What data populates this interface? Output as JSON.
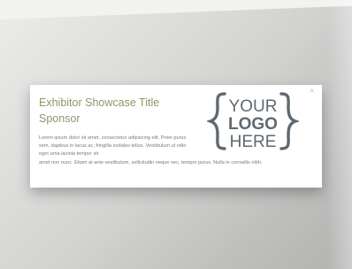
{
  "modal": {
    "title_line1": "Exhibitor Showcase Title",
    "title_line2": "Sponsor",
    "close_symbol": "×",
    "body_part1": "Lorem ipsum dolor sit amet, consectetur adipiscing elit. Proin purus sem, dapibus in lacus ac, fringilla sodales tellus. Vestibulum ut odio eget urna lacinia tempor sit",
    "body_part2": "amet non nunc. Etiam at ante vestibulum, sollicitudin neque nec, tempor purus. Nulla in convallis nibh.",
    "logo": {
      "line1": "YOUR",
      "line2": "LOGO",
      "line3": "HERE",
      "icon": "curly-brace-logo-placeholder",
      "color": "#5f6a70"
    }
  },
  "colors": {
    "title": "#8a9a68",
    "body_text": "#7a7a7a",
    "backdrop": "#d2d3d1"
  }
}
